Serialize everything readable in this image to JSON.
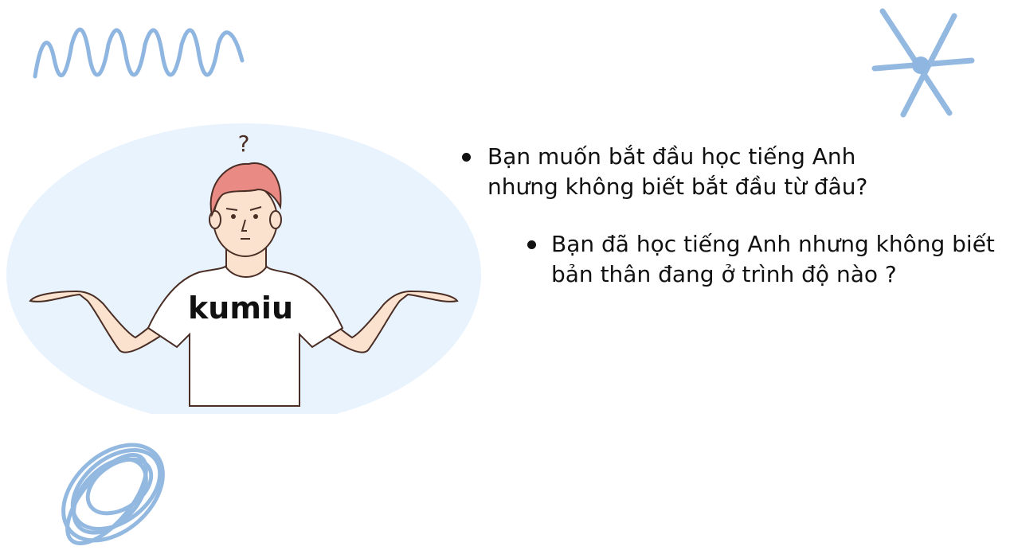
{
  "illustration": {
    "question_mark": "?",
    "shirt_text": "kumiu"
  },
  "bullets": [
    {
      "text": "Bạn muốn bắt đầu học tiếng Anh nhưng không biết bắt đầu từ đâu?"
    },
    {
      "text": "Bạn đã học tiếng Anh nhưng không biết bản thân đang ở trình độ nào ?"
    }
  ],
  "colors": {
    "doodle_blue": "#8fb6e0",
    "bubble_blue": "#e8f3fd",
    "hair": "#e98a84",
    "skin": "#fbe2cf",
    "outline": "#4a2e25"
  }
}
